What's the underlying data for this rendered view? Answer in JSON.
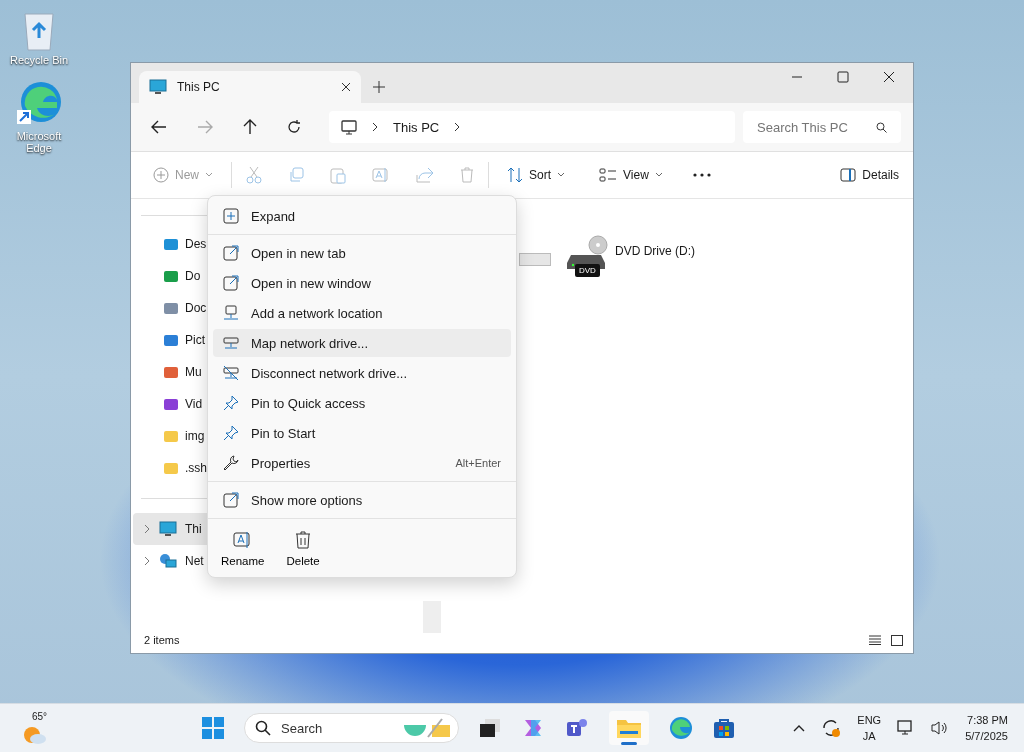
{
  "desktop": {
    "icons": [
      {
        "label": "Recycle Bin"
      },
      {
        "label": "Microsoft Edge"
      }
    ]
  },
  "window": {
    "tabs": [
      {
        "label": "This PC",
        "selected": true
      }
    ],
    "nav": {
      "back_disabled": false,
      "forward_disabled": true
    },
    "address": {
      "crumbs": [
        "This PC"
      ]
    },
    "search": {
      "placeholder": "Search This PC"
    },
    "toolbar": {
      "new": {
        "label": "New",
        "disabled": true
      },
      "sort": "Sort",
      "view": "View",
      "details": "Details"
    },
    "sidebar": {
      "quick": [
        {
          "label": "Des"
        },
        {
          "label": "Do"
        },
        {
          "label": "Doc"
        },
        {
          "label": "Pict"
        },
        {
          "label": "Mu"
        },
        {
          "label": "Vid"
        },
        {
          "label": "img"
        },
        {
          "label": ".ssh"
        }
      ],
      "roots": [
        {
          "label": "Thi",
          "selected": true
        },
        {
          "label": "Net",
          "selected": false
        }
      ]
    },
    "drives": [
      {
        "label": "DVD Drive (D:)",
        "badge": "DVD"
      }
    ],
    "status_bar": {
      "count": "2 items"
    }
  },
  "context_menu": {
    "groups": [
      [
        {
          "label": "Expand",
          "selected": false
        }
      ],
      [
        {
          "label": "Open in new tab",
          "selected": false
        },
        {
          "label": "Open in new window",
          "selected": false
        },
        {
          "label": "Add a network location",
          "selected": false
        },
        {
          "label": "Map network drive...",
          "selected": true
        },
        {
          "label": "Disconnect network drive...",
          "selected": false
        },
        {
          "label": "Pin to Quick access",
          "selected": false
        },
        {
          "label": "Pin to Start",
          "selected": false
        },
        {
          "label": "Properties",
          "selected": false,
          "shortcut": "Alt+Enter"
        }
      ],
      [
        {
          "label": "Show more options",
          "selected": false
        }
      ]
    ],
    "actions": [
      {
        "label": "Rename"
      },
      {
        "label": "Delete"
      }
    ]
  },
  "taskbar": {
    "weather": "65°",
    "search": "Search",
    "language": {
      "top": "ENG",
      "bottom": "JA"
    },
    "time": "7:38 PM",
    "date": "5/7/2025"
  }
}
